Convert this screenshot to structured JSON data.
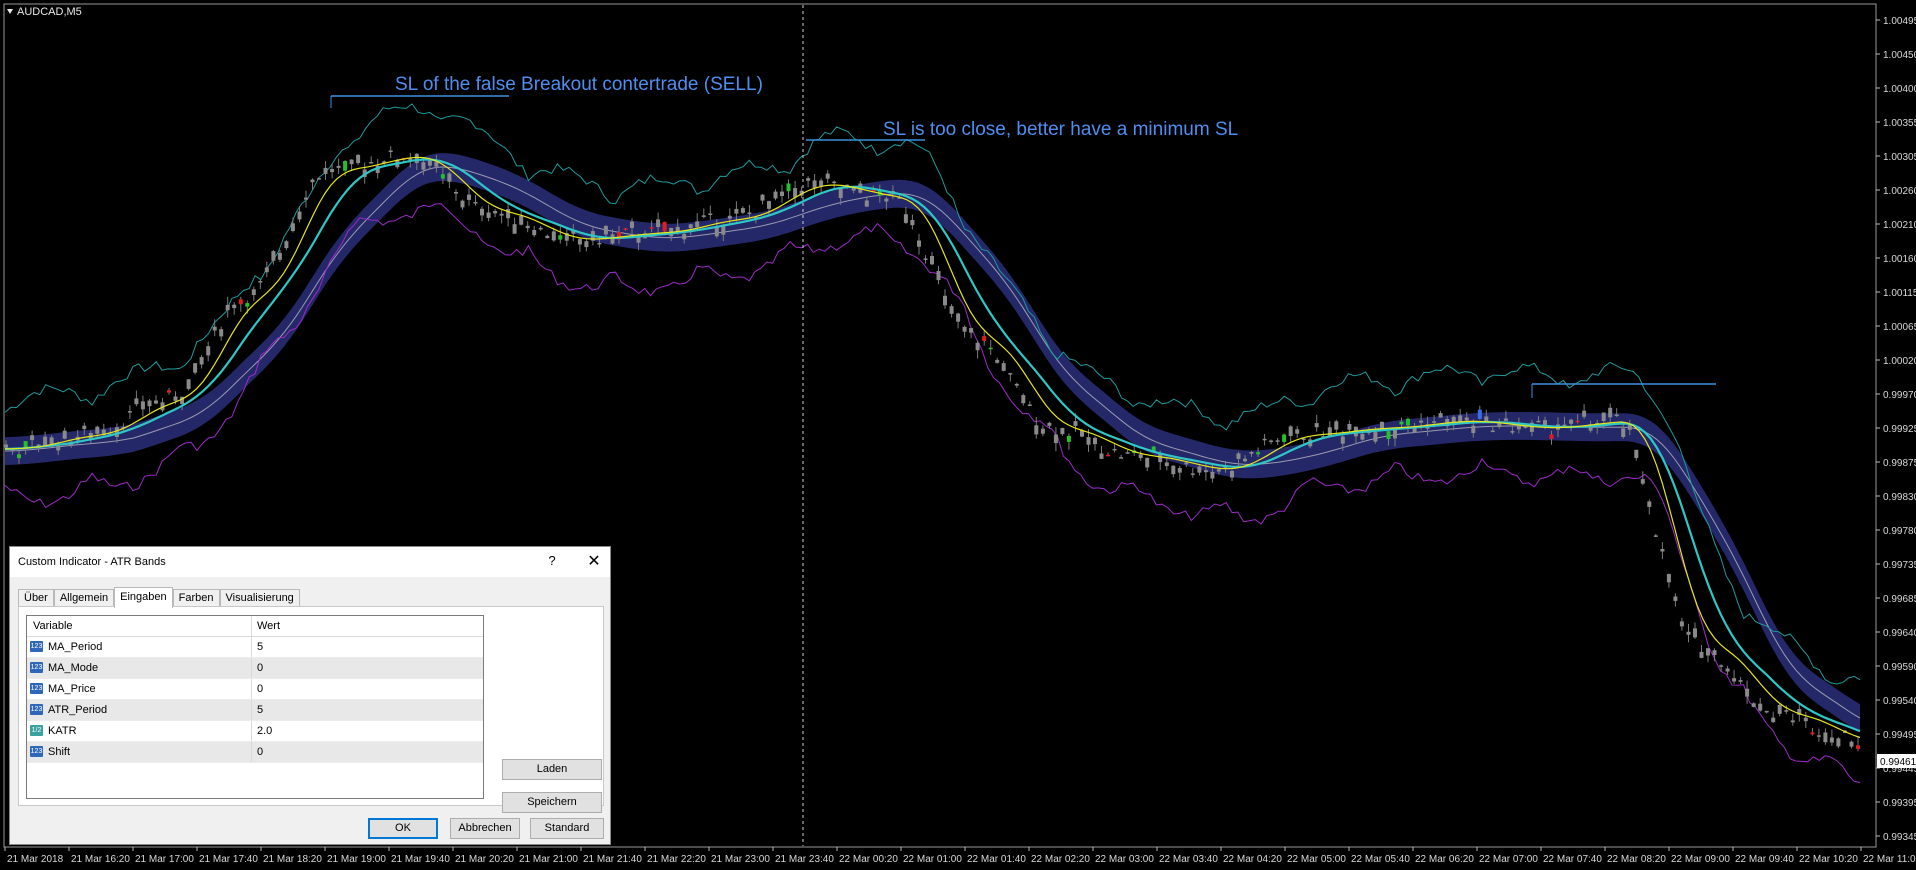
{
  "symbol_label": "AUDCAD,M5",
  "annotations": [
    "SL of the false Breakout contertrade (SELL)",
    "SL is too close, better have a minimum SL"
  ],
  "price_axis": {
    "labels": [
      "1.00495",
      "1.00450",
      "1.00400",
      "1.00355",
      "1.00305",
      "1.00260",
      "1.00210",
      "1.00160",
      "1.00115",
      "1.00065",
      "1.00020",
      "0.99970",
      "0.99925",
      "0.99875",
      "0.99830",
      "0.99780",
      "0.99735",
      "0.99685",
      "0.99640",
      "0.99590",
      "0.99540",
      "0.99495",
      "0.99445",
      "0.99395",
      "0.99345"
    ],
    "current_price": "0.99461"
  },
  "time_axis": {
    "labels": [
      "21 Mar 2018",
      "21 Mar 16:20",
      "21 Mar 17:00",
      "21 Mar 17:40",
      "21 Mar 18:20",
      "21 Mar 19:00",
      "21 Mar 19:40",
      "21 Mar 20:20",
      "21 Mar 21:00",
      "21 Mar 21:40",
      "21 Mar 22:20",
      "21 Mar 23:00",
      "21 Mar 23:40",
      "22 Mar 00:20",
      "22 Mar 01:00",
      "22 Mar 01:40",
      "22 Mar 02:20",
      "22 Mar 03:00",
      "22 Mar 03:40",
      "22 Mar 04:20",
      "22 Mar 05:00",
      "22 Mar 05:40",
      "22 Mar 06:20",
      "22 Mar 07:00",
      "22 Mar 07:40",
      "22 Mar 08:20",
      "22 Mar 09:00",
      "22 Mar 09:40",
      "22 Mar 10:20",
      "22 Mar 11:00"
    ]
  },
  "chart_data": {
    "type": "candlestick",
    "series": [
      {
        "x": "21 Mar 16:00",
        "y": 0.9988
      },
      {
        "x": "21 Mar 17:00",
        "y": 0.999
      },
      {
        "x": "21 Mar 17:40",
        "y": 0.9995
      },
      {
        "x": "21 Mar 18:00",
        "y": 1.001
      },
      {
        "x": "21 Mar 18:40",
        "y": 1.0028
      },
      {
        "x": "21 Mar 19:00",
        "y": 1.003
      },
      {
        "x": "21 Mar 20:00",
        "y": 1.0022
      },
      {
        "x": "21 Mar 21:00",
        "y": 1.0018
      },
      {
        "x": "21 Mar 22:00",
        "y": 1.0019
      },
      {
        "x": "21 Mar 23:00",
        "y": 1.0021
      },
      {
        "x": "21 Mar 23:40",
        "y": 1.0026
      },
      {
        "x": "22 Mar 00:20",
        "y": 1.0024
      },
      {
        "x": "22 Mar 01:00",
        "y": 1.0004
      },
      {
        "x": "22 Mar 02:00",
        "y": 0.9991
      },
      {
        "x": "22 Mar 03:00",
        "y": 0.9987
      },
      {
        "x": "22 Mar 04:00",
        "y": 0.9985
      },
      {
        "x": "22 Mar 05:00",
        "y": 0.999
      },
      {
        "x": "22 Mar 06:00",
        "y": 0.9991
      },
      {
        "x": "22 Mar 07:00",
        "y": 0.9992
      },
      {
        "x": "22 Mar 08:00",
        "y": 0.9991
      },
      {
        "x": "22 Mar 08:20",
        "y": 0.9992
      },
      {
        "x": "22 Mar 09:00",
        "y": 0.996
      },
      {
        "x": "22 Mar 10:00",
        "y": 0.995
      },
      {
        "x": "22 Mar 11:00",
        "y": 0.9946
      }
    ]
  },
  "dialog": {
    "title": "Custom Indicator - ATR Bands",
    "help": "?",
    "close": "✕",
    "tabs": [
      "Über",
      "Allgemein",
      "Eingaben",
      "Farben",
      "Visualisierung"
    ],
    "active_tab": "Eingaben",
    "columns": [
      "Variable",
      "Wert"
    ],
    "rows": [
      {
        "icon": "123",
        "name": "MA_Period",
        "value": "5"
      },
      {
        "icon": "123",
        "name": "MA_Mode",
        "value": "0"
      },
      {
        "icon": "123",
        "name": "MA_Price",
        "value": "0"
      },
      {
        "icon": "123",
        "name": "ATR_Period",
        "value": "5"
      },
      {
        "icon": "1/2",
        "name": "KATR",
        "value": "2.0"
      },
      {
        "icon": "123",
        "name": "Shift",
        "value": "0"
      }
    ],
    "buttons": {
      "load": "Laden",
      "save": "Speichern",
      "ok": "OK",
      "cancel": "Abbrechen",
      "default": "Standard"
    }
  }
}
